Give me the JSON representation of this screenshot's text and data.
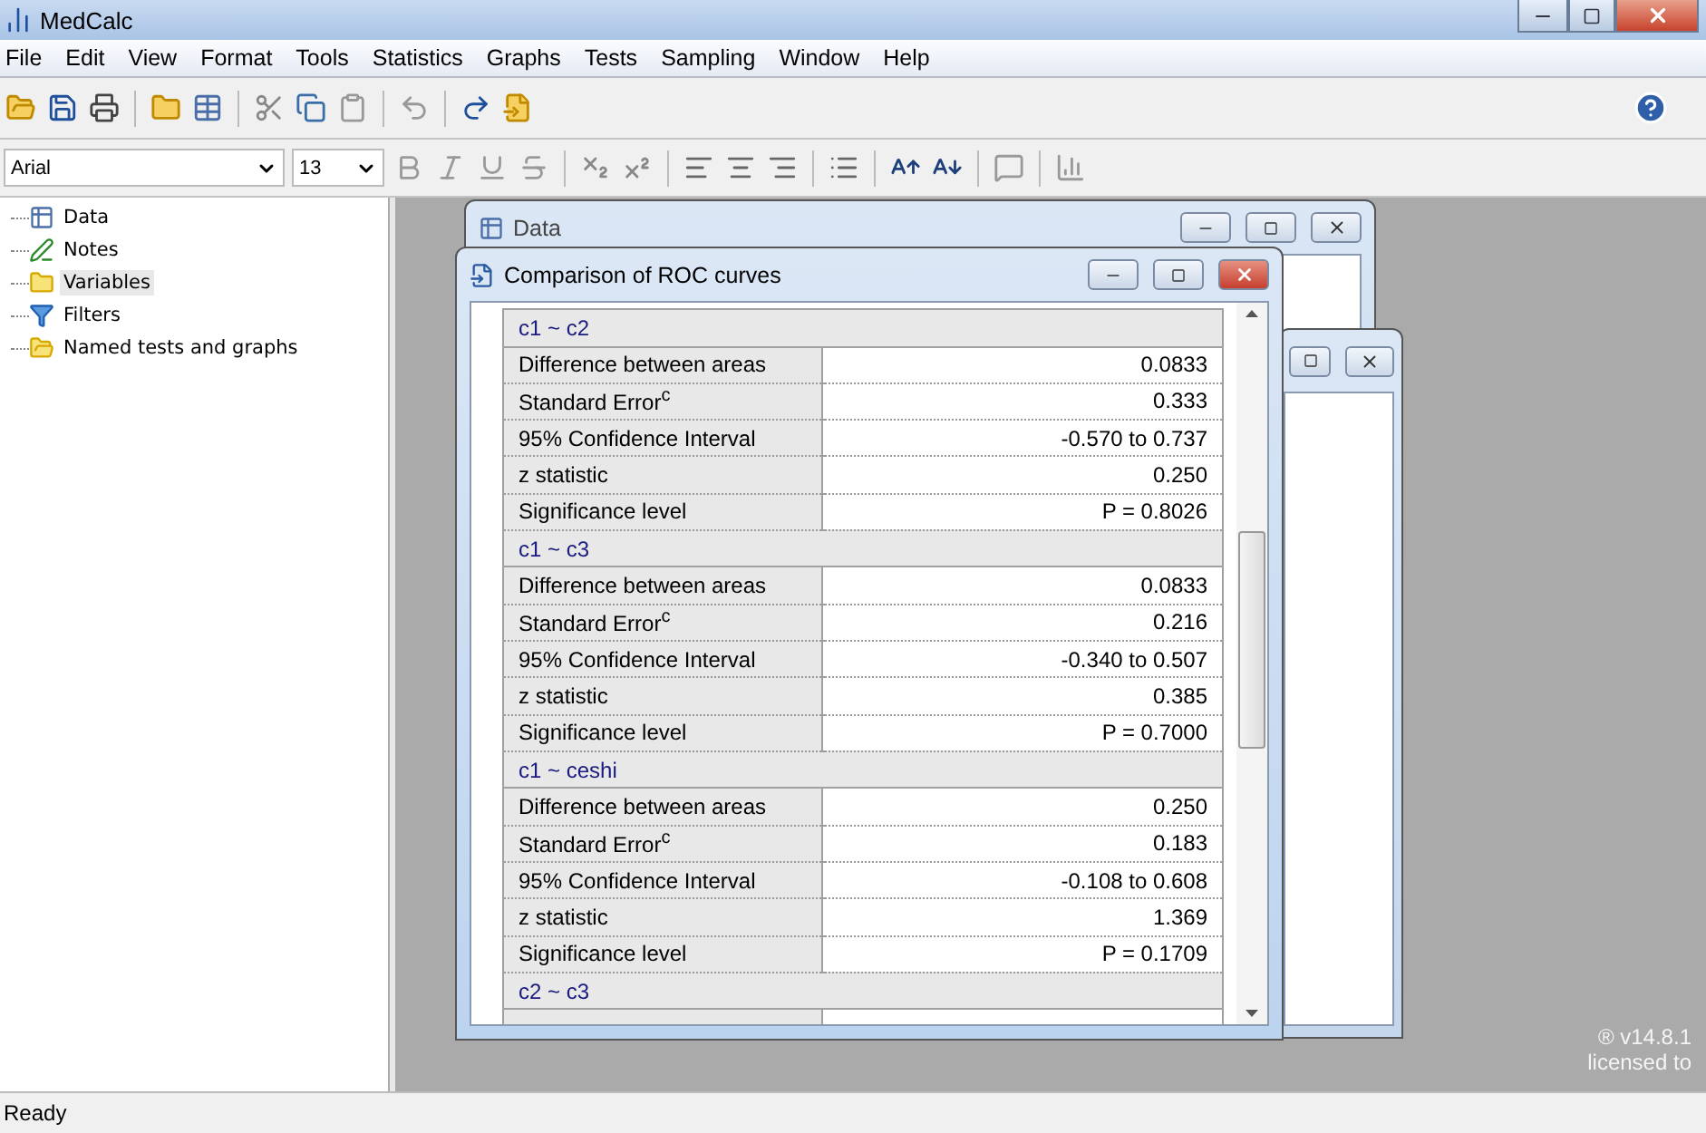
{
  "window": {
    "title": "MedCalc"
  },
  "menu": [
    "File",
    "Edit",
    "View",
    "Format",
    "Tools",
    "Statistics",
    "Graphs",
    "Tests",
    "Sampling",
    "Window",
    "Help"
  ],
  "format_bar": {
    "font": "Arial",
    "size": "13"
  },
  "sidebar": {
    "items": [
      {
        "label": "Data",
        "kind": "table",
        "selected": false
      },
      {
        "label": "Notes",
        "kind": "notes",
        "selected": false
      },
      {
        "label": "Variables",
        "kind": "folder",
        "selected": true
      },
      {
        "label": "Filters",
        "kind": "filter",
        "selected": false
      },
      {
        "label": "Named tests and graphs",
        "kind": "named",
        "selected": false
      }
    ]
  },
  "data_window": {
    "title": "Data"
  },
  "roc_window": {
    "title": "Comparison of ROC curves",
    "sections": [
      {
        "heading": "c1 ~ c2",
        "rows": [
          {
            "label": "Difference between areas",
            "value": "0.0833"
          },
          {
            "label": "Standard Error$^{c}$",
            "value": "0.333"
          },
          {
            "label": "95% Confidence Interval",
            "value": "-0.570 to 0.737"
          },
          {
            "label": "z statistic",
            "value": "0.250"
          },
          {
            "label": "Significance level",
            "value": "P = 0.8026"
          }
        ]
      },
      {
        "heading": "c1 ~ c3",
        "rows": [
          {
            "label": "Difference between areas",
            "value": "0.0833"
          },
          {
            "label": "Standard Error$^{c}$",
            "value": "0.216"
          },
          {
            "label": "95% Confidence Interval",
            "value": "-0.340 to 0.507"
          },
          {
            "label": "z statistic",
            "value": "0.385"
          },
          {
            "label": "Significance level",
            "value": "P = 0.7000"
          }
        ]
      },
      {
        "heading": "c1 ~ ceshi",
        "rows": [
          {
            "label": "Difference between areas",
            "value": "0.250"
          },
          {
            "label": "Standard Error$^{c}$",
            "value": "0.183"
          },
          {
            "label": "95% Confidence Interval",
            "value": "-0.108 to 0.608"
          },
          {
            "label": "z statistic",
            "value": "1.369"
          },
          {
            "label": "Significance level",
            "value": "P = 0.1709"
          }
        ]
      },
      {
        "heading": "c2 ~ c3"
      }
    ]
  },
  "workspace_note": [
    "® v14.8.1",
    "licensed to"
  ],
  "status_bar": {
    "text": "Ready"
  }
}
